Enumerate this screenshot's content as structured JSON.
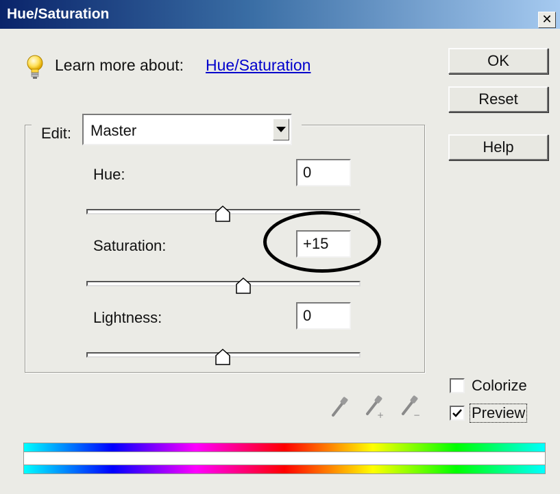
{
  "window": {
    "title": "Hue/Saturation",
    "close_glyph": "✕"
  },
  "learn": {
    "prefix": "Learn more about:",
    "link": "Hue/Saturation",
    "icon": "lightbulb-icon"
  },
  "buttons": {
    "ok": "OK",
    "reset": "Reset",
    "help": "Help"
  },
  "edit": {
    "label": "Edit:",
    "selected": "Master",
    "icon": "chevron-down-icon"
  },
  "adjustments": {
    "hue": {
      "label": "Hue:",
      "value": "0"
    },
    "saturation": {
      "label": "Saturation:",
      "value": "+15"
    },
    "lightness": {
      "label": "Lightness:",
      "value": "0"
    }
  },
  "options": {
    "colorize": {
      "label": "Colorize",
      "checked": false
    },
    "preview": {
      "label": "Preview",
      "checked": true
    }
  },
  "tools": [
    "eyedropper-icon",
    "eyedropper-plus-icon",
    "eyedropper-minus-icon"
  ],
  "colors": {
    "title_gradient_start": "#0a246a",
    "title_gradient_end": "#a6caf0",
    "link": "#0000cc",
    "dialog_bg": "#ebebe6"
  }
}
